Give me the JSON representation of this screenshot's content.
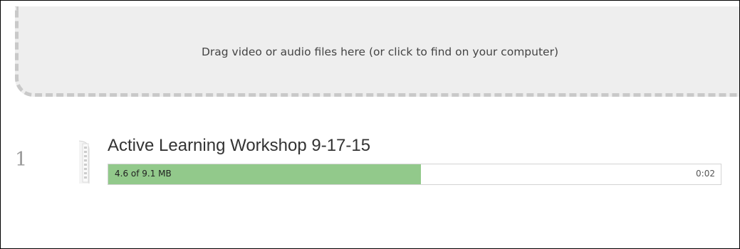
{
  "dropzone": {
    "text": "Drag video or audio files here (or click to find on your computer)"
  },
  "uploads": [
    {
      "index": "1",
      "icon": "film-file-icon",
      "title": "Active Learning Workshop 9-17-15",
      "size_text": "4.6 of 9.1 MB",
      "time_text": "0:02",
      "progress": 0.51
    }
  ],
  "colors": {
    "progress_fill": "#92c98b",
    "dropzone_bg": "#eeeeee",
    "dropzone_border": "#c9c9c9"
  }
}
